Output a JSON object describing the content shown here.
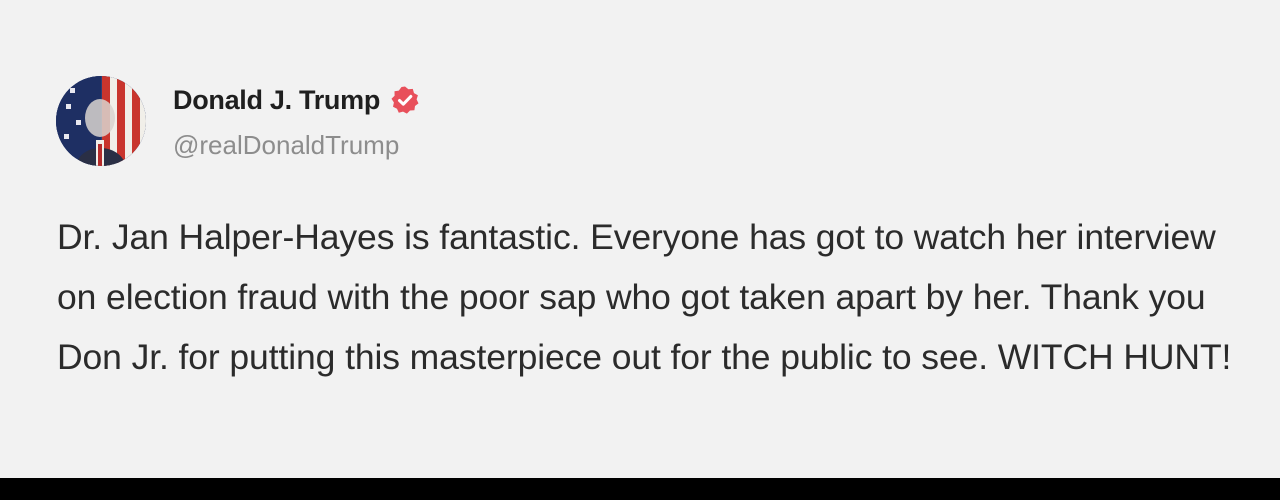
{
  "post": {
    "author": {
      "display_name": "Donald J. Trump",
      "handle": "@realDonaldTrump",
      "verified_icon": "verified-badge-icon",
      "avatar_icon": "american-flag-portrait"
    },
    "text": "Dr. Jan Halper-Hayes is fantastic. Everyone has got to watch her interview on election fraud with the poor sap who got taken apart by her. Thank you Don Jr. for putting this masterpiece out for the public to see. WITCH HUNT!"
  },
  "colors": {
    "card_background": "#f2f2f2",
    "name_text": "#1f1f1f",
    "handle_text": "#8d8d8d",
    "body_text": "#2b2b2b",
    "verified_badge": "#e8505b",
    "frame": "#000000"
  }
}
